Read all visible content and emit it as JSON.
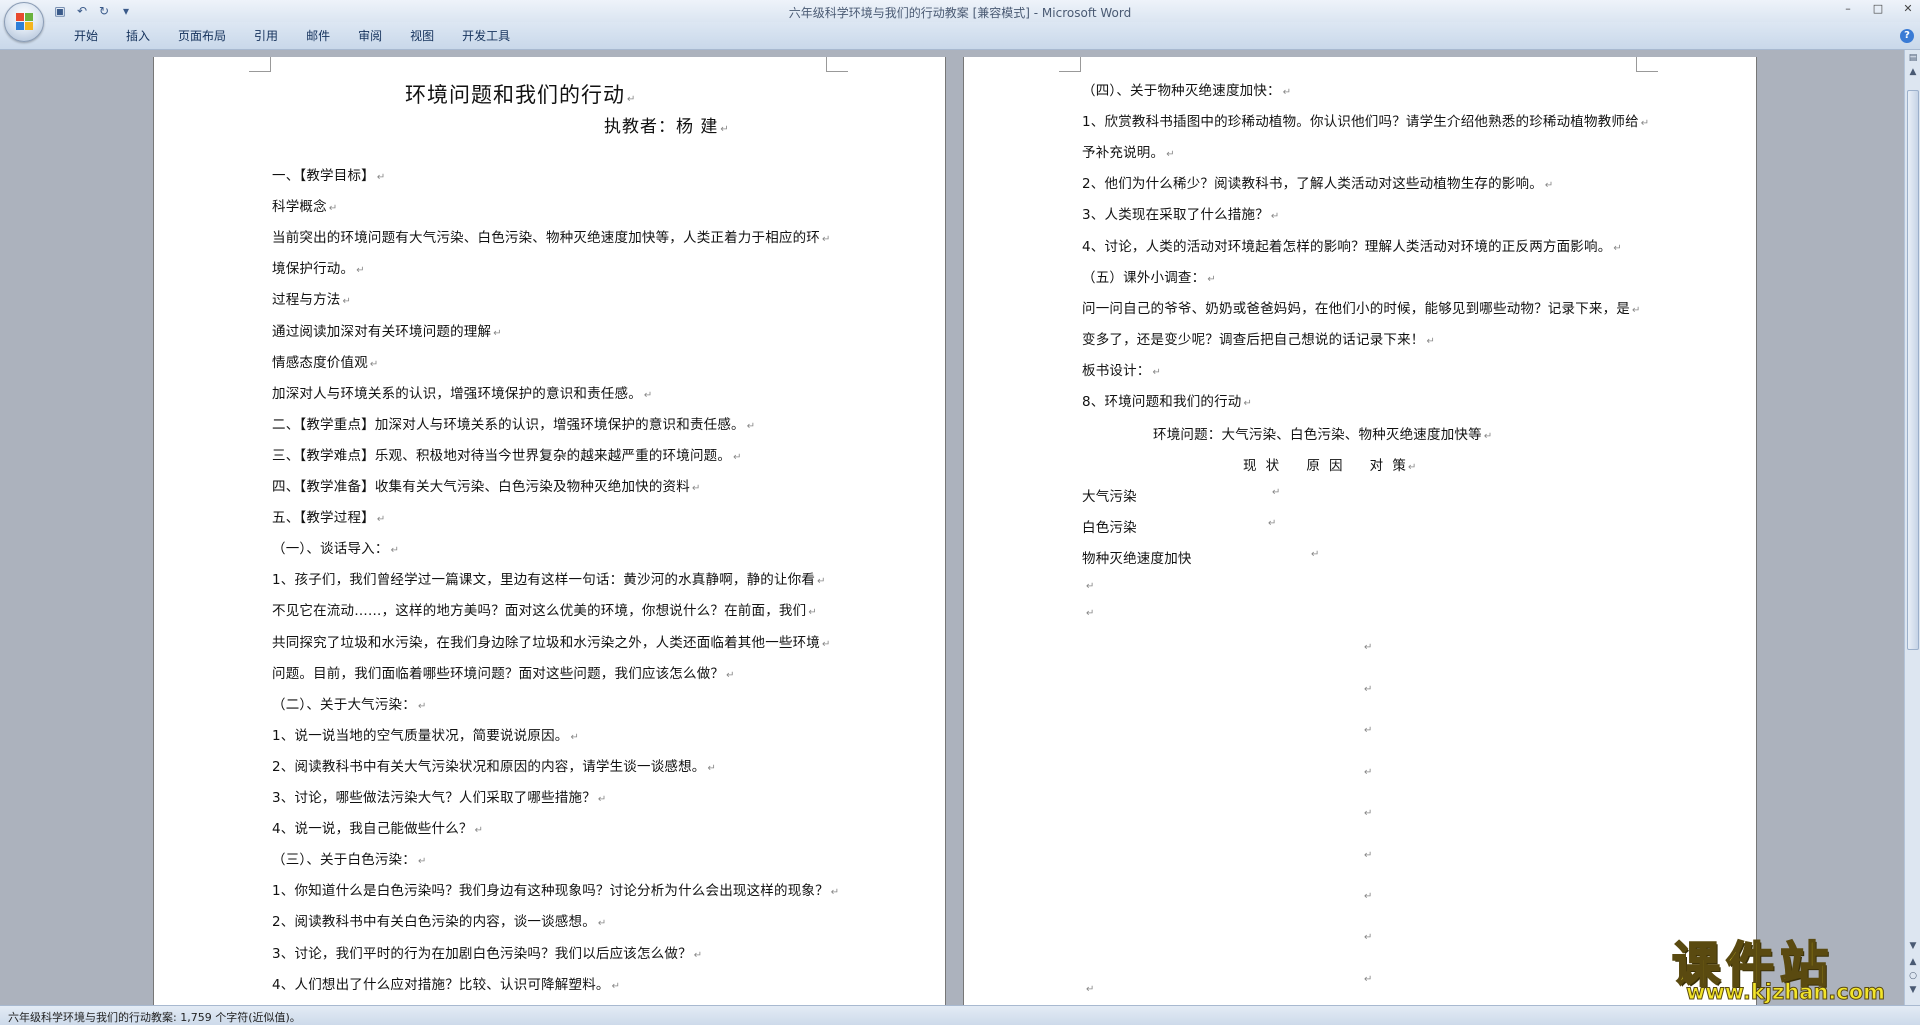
{
  "window": {
    "title": "六年级科学环境与我们的行动教案 [兼容模式] - Microsoft Word"
  },
  "ribbon": {
    "tabs": [
      "开始",
      "插入",
      "页面布局",
      "引用",
      "邮件",
      "审阅",
      "视图",
      "开发工具"
    ]
  },
  "page1": {
    "heading": "环境问题和我们的行动",
    "author": "执教者：杨    建",
    "lines": [
      "一、【教学目标】",
      "科学概念",
      "当前突出的环境问题有大气污染、白色污染、物种灭绝速度加快等，人类正着力于相应的环",
      "境保护行动。",
      "过程与方法",
      "通过阅读加深对有关环境问题的理解",
      "情感态度价值观",
      "加深对人与环境关系的认识，增强环境保护的意识和责任感。",
      "二、【教学重点】加深对人与环境关系的认识，增强环境保护的意识和责任感。",
      "三、【教学难点】乐观、积极地对待当今世界复杂的越来越严重的环境问题。",
      "四、【教学准备】收集有关大气污染、白色污染及物种灭绝加快的资料",
      "五、【教学过程】",
      "（一）、谈话导入：",
      "1、孩子们，我们曾经学过一篇课文，里边有这样一句话：黄沙河的水真静啊，静的让你看",
      "不见它在流动……，这样的地方美吗？面对这么优美的环境，你想说什么？在前面，我们",
      "共同探究了垃圾和水污染，在我们身边除了垃圾和水污染之外，人类还面临着其他一些环境",
      "问题。目前，我们面临着哪些环境问题？面对这些问题，我们应该怎么做？",
      "（二）、关于大气污染：",
      "1、说一说当地的空气质量状况，简要说说原因。",
      "2、阅读教科书中有关大气污染状况和原因的内容，请学生谈一谈感想。",
      "3、讨论，哪些做法污染大气？人们采取了哪些措施？",
      "4、说一说，我自己能做些什么？",
      "（三）、关于白色污染：",
      "1、你知道什么是白色污染吗？我们身边有这种现象吗？讨论分析为什么会出现这样的现象？",
      "2、阅读教科书中有关白色污染的内容，谈一谈感想。",
      "3、讨论，我们平时的行为在加剧白色污染吗？我们以后应该怎么做？",
      "4、人们想出了什么应对措施？比较、认识可降解塑料。"
    ]
  },
  "page2": {
    "lines": [
      "（四）、关于物种灭绝速度加快：",
      "1、欣赏教科书插图中的珍稀动植物。你认识他们吗？请学生介绍他熟悉的珍稀动植物教师给",
      "予补充说明。",
      "2、他们为什么稀少？阅读教科书，了解人类活动对这些动植物生存的影响。",
      "3、人类现在采取了什么措施？",
      "4、讨论，人类的活动对环境起着怎样的影响？理解人类活动对环境的正反两方面影响。",
      "（五）课外小调查：",
      "问一问自己的爷爷、奶奶或爸爸妈妈，在他们小的时候，能够见到哪些动物？记录下来，是",
      "变多了，还是变少呢？调查后把自己想说的话记录下来！",
      "板书设计：",
      "8、环境问题和我们的行动"
    ],
    "board_subtitle": "环境问题：大气污染、白色污染、物种灭绝速度加快等",
    "board_headers": "现  状      原  因      对  策",
    "board_rows": [
      "大气污染",
      "白色污染",
      "物种灭绝速度加快"
    ]
  },
  "statusbar": {
    "text": "六年级科学环境与我们的行动教案: 1,759 个字符(近似值)。"
  },
  "watermark": {
    "main": "课件站",
    "url": "www.kjzhan.com"
  },
  "paragraph_mark": "↵"
}
